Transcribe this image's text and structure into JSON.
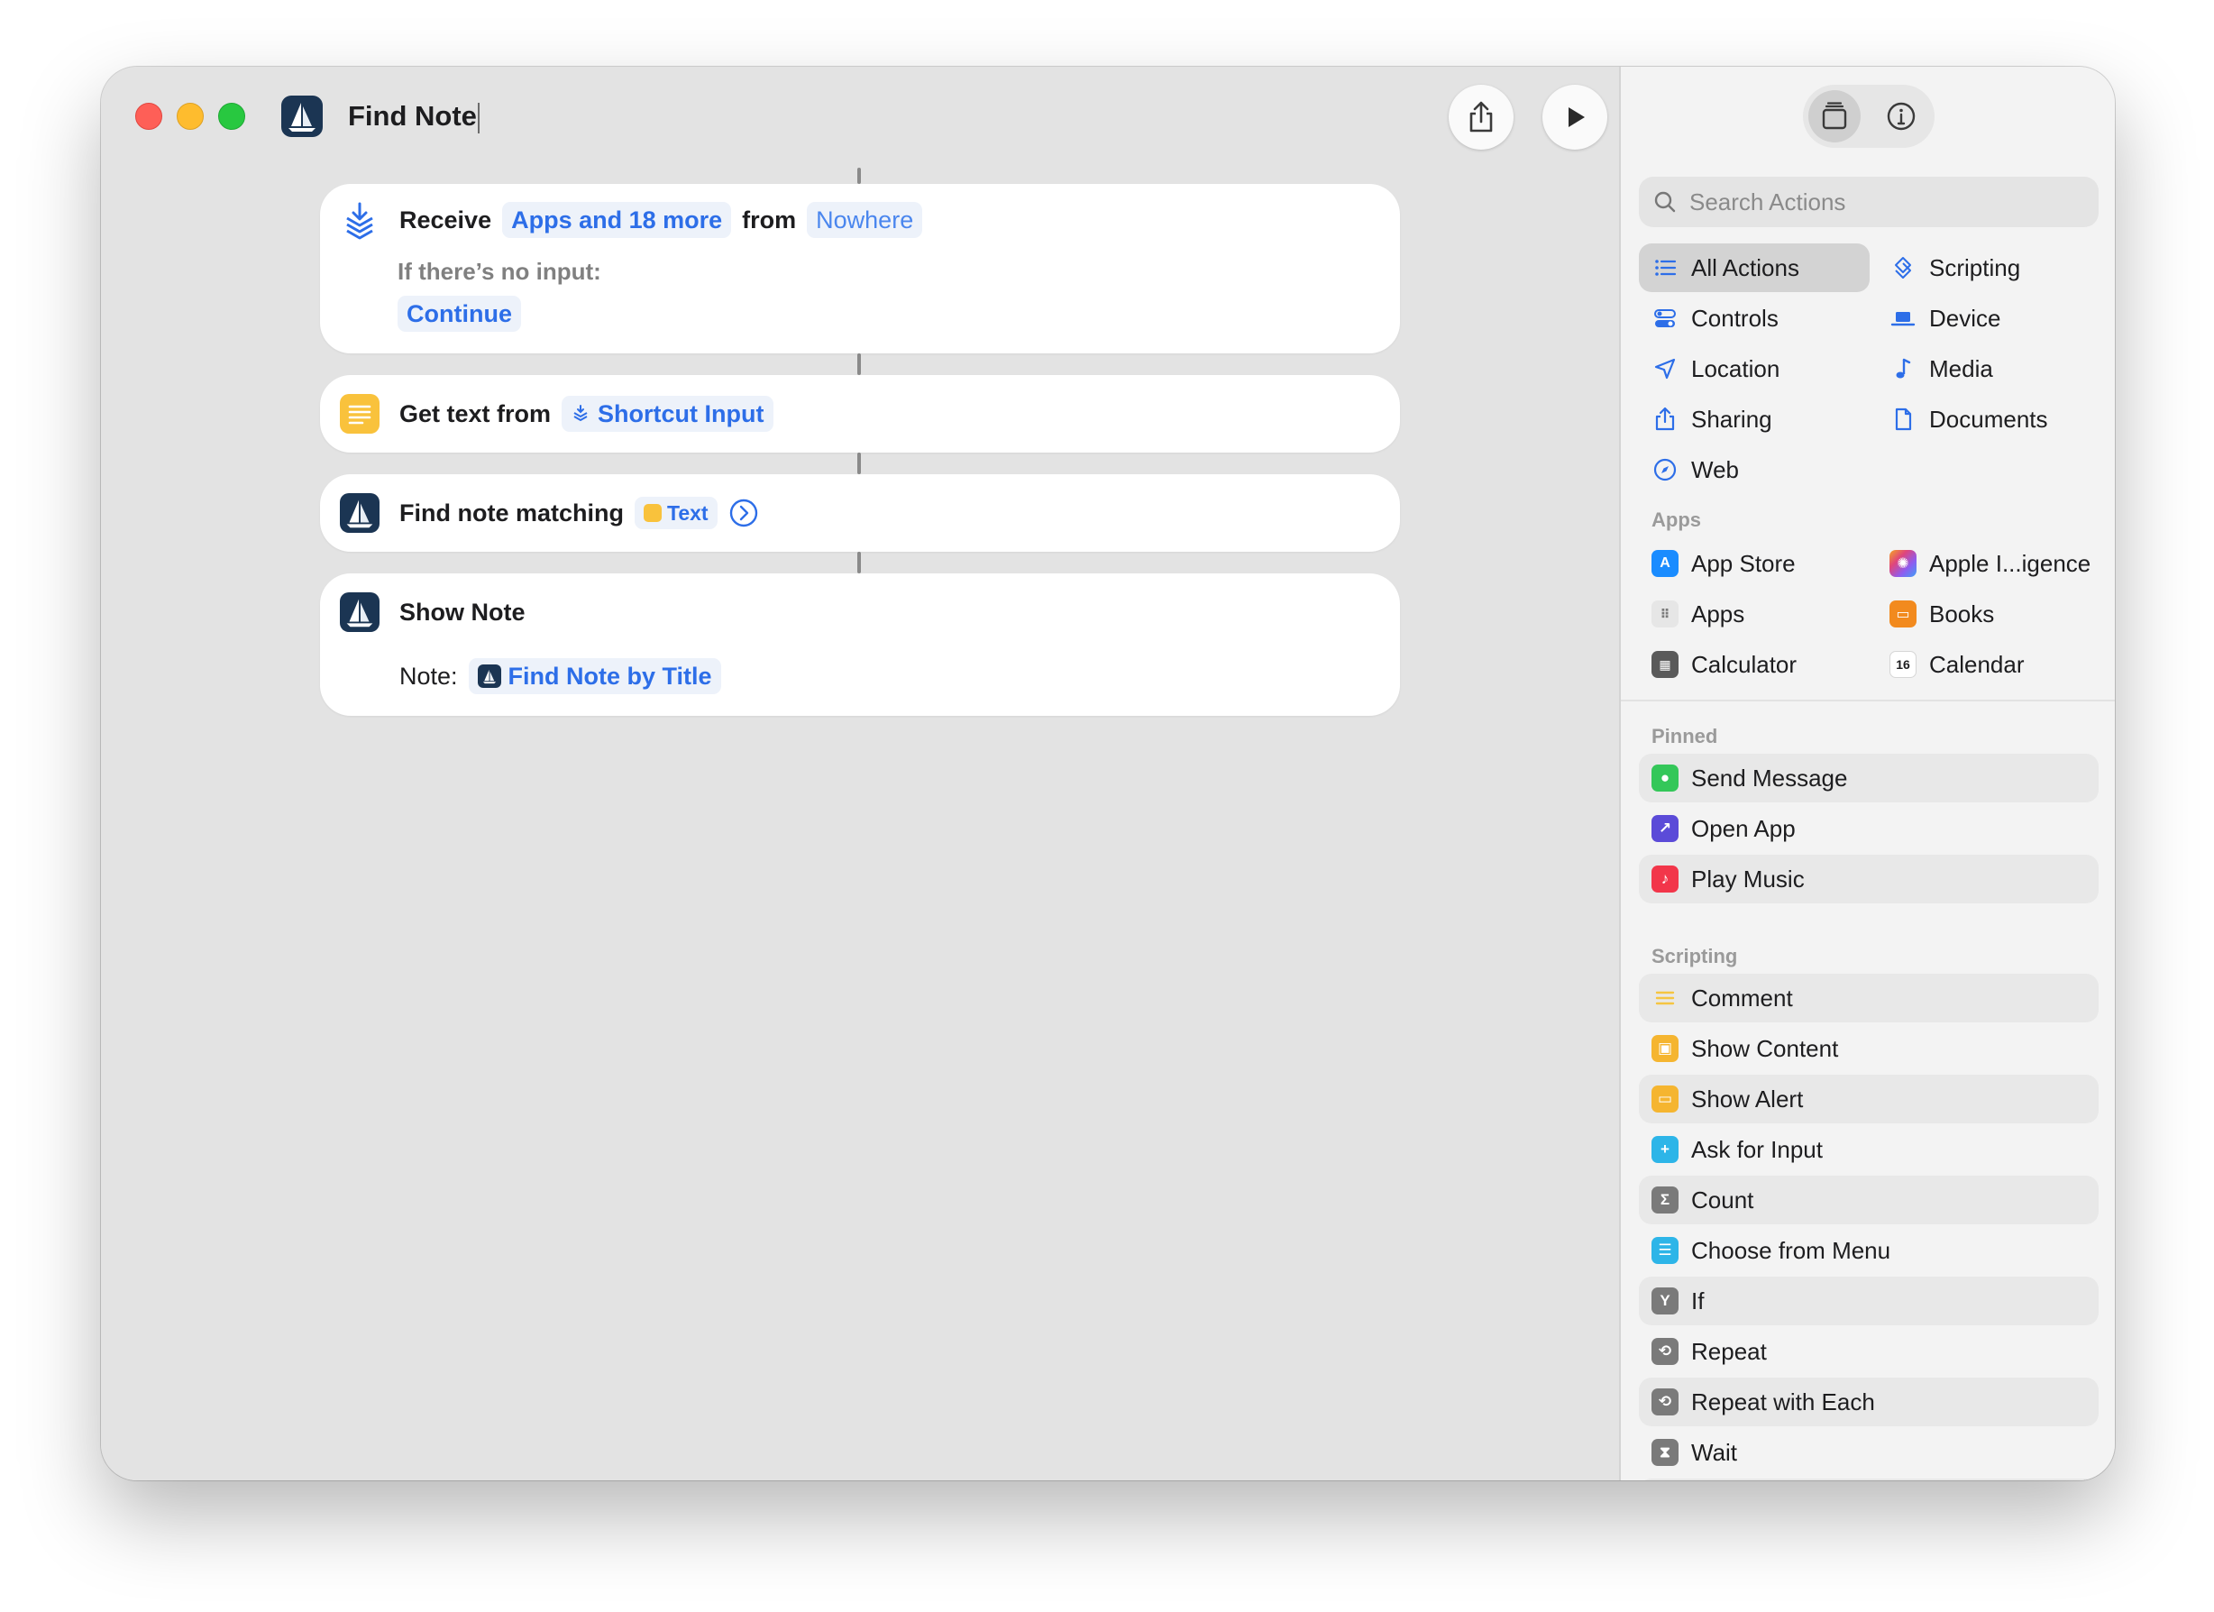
{
  "window": {
    "title": "Find Note"
  },
  "toolbar": {
    "share_icon": "share-icon",
    "run_icon": "play-icon"
  },
  "actions": [
    {
      "icon": "receive-icon",
      "verb": "Receive",
      "types": "Apps and 18 more",
      "from_label": "from",
      "source": "Nowhere",
      "no_input_label": "If there’s no input:",
      "no_input_action": "Continue"
    },
    {
      "icon": "text-icon",
      "verb": "Get text from",
      "input": "Shortcut Input"
    },
    {
      "icon": "app-icon",
      "verb": "Find note matching",
      "param": "Text"
    },
    {
      "icon": "app-icon",
      "verb": "Show Note",
      "note_label": "Note:",
      "note_value": "Find Note by Title"
    }
  ],
  "sidebar": {
    "search_placeholder": "Search Actions",
    "categories": [
      {
        "label": "All Actions",
        "icon": "list-icon",
        "selected": true
      },
      {
        "label": "Scripting",
        "icon": "scripting-icon"
      },
      {
        "label": "Controls",
        "icon": "toggle-icon"
      },
      {
        "label": "Device",
        "icon": "laptop-icon"
      },
      {
        "label": "Location",
        "icon": "location-icon"
      },
      {
        "label": "Media",
        "icon": "music-note-icon"
      },
      {
        "label": "Sharing",
        "icon": "share-icon"
      },
      {
        "label": "Documents",
        "icon": "document-icon"
      },
      {
        "label": "Web",
        "icon": "compass-icon"
      }
    ],
    "apps_label": "Apps",
    "apps": [
      {
        "label": "App Store",
        "color": "#1a8cff"
      },
      {
        "label": "Apple I...igence",
        "color": "#c86bd6"
      },
      {
        "label": "Apps",
        "color": "#e4e4e4"
      },
      {
        "label": "Books",
        "color": "#f28a1e"
      },
      {
        "label": "Calculator",
        "color": "#5a5a5a"
      },
      {
        "label": "Calendar",
        "color": "#ffffff",
        "day": "16"
      }
    ],
    "pinned_label": "Pinned",
    "pinned": [
      {
        "label": "Send Message",
        "color": "#34c759"
      },
      {
        "label": "Open App",
        "color": "#5b4bd8"
      },
      {
        "label": "Play Music",
        "color": "#f2364a"
      }
    ],
    "scripting_label": "Scripting",
    "scripting": [
      {
        "label": "Comment",
        "color": "#f5c542"
      },
      {
        "label": "Show Content",
        "color": "#f5b530"
      },
      {
        "label": "Show Alert",
        "color": "#f5b530"
      },
      {
        "label": "Ask for Input",
        "color": "#2db5e8"
      },
      {
        "label": "Count",
        "color": "#7a7a7a",
        "glyph": "Σ"
      },
      {
        "label": "Choose from Menu",
        "color": "#2db5e8"
      },
      {
        "label": "If",
        "color": "#7a7a7a",
        "glyph": "Y"
      },
      {
        "label": "Repeat",
        "color": "#7a7a7a",
        "glyph": "⟲"
      },
      {
        "label": "Repeat with Each",
        "color": "#7a7a7a",
        "glyph": "⟲"
      },
      {
        "label": "Wait",
        "color": "#7a7a7a",
        "glyph": "⧗"
      }
    ]
  }
}
